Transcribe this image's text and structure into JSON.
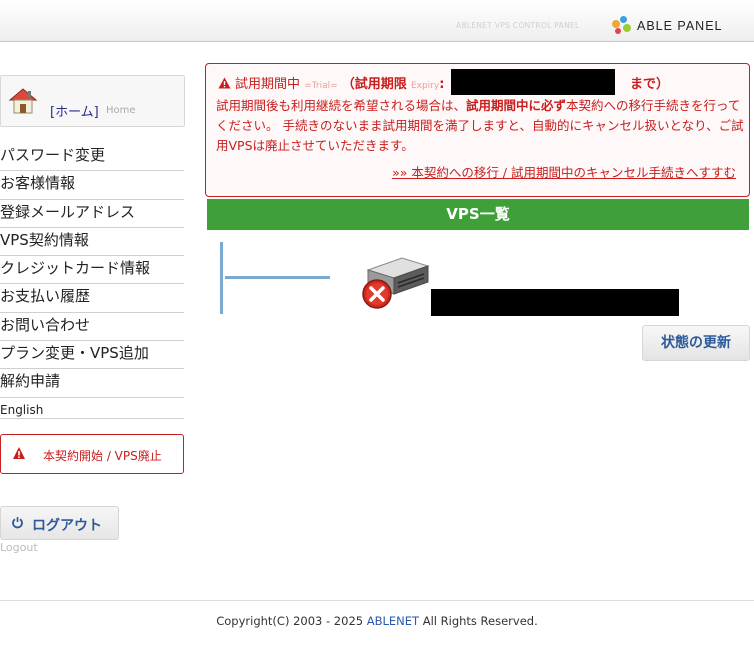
{
  "header": {
    "control_panel_text": "ABLENET VPS CONTROL PANEL",
    "brand": "ABLE PANEL"
  },
  "sidebar": {
    "home_label": "[ホーム]",
    "home_sub": "Home",
    "menu": [
      "パスワード変更",
      "お客様情報",
      "登録メールアドレス",
      "VPS契約情報",
      "クレジットカード情報",
      "お支払い履歴",
      "お問い合わせ",
      "プラン変更・VPS追加",
      "解約申請"
    ],
    "language": "English",
    "cancel_button": "本契約開始 / VPS廃止",
    "logout_label": "ログアウト",
    "logout_sub": "Logout"
  },
  "notice": {
    "trial_label": "試用期間中",
    "trial_sub": "=Trial=",
    "period_label": "（試用期限",
    "expiry_sub": "Expiry",
    "colon": ":",
    "until": "まで）",
    "body_part1": "試用期間後も利用継続を希望される場合は、",
    "body_bold": "試用期間中に必ず",
    "body_part2": "本契約への移行手続きを行ってください。 手続きのないまま試用期間を満了しますと、自動的にキャンセル扱いとなり、ご試用VPSは廃止させていただきます。",
    "link": "»» 本契約への移行 / 試用期間中のキャンセル手続きへすすむ"
  },
  "vps": {
    "list_title": "VPS一覧",
    "refresh_button": "状態の更新"
  },
  "footer": {
    "copyright_prefix": "Copyright(C) 2003 - 2025 ",
    "company": "ABLENET",
    "copyright_suffix": " All Rights Reserved."
  },
  "colors": {
    "accent_red": "#c81e1e",
    "list_green": "#3fa03a",
    "button_blue": "#2d5a9a"
  }
}
